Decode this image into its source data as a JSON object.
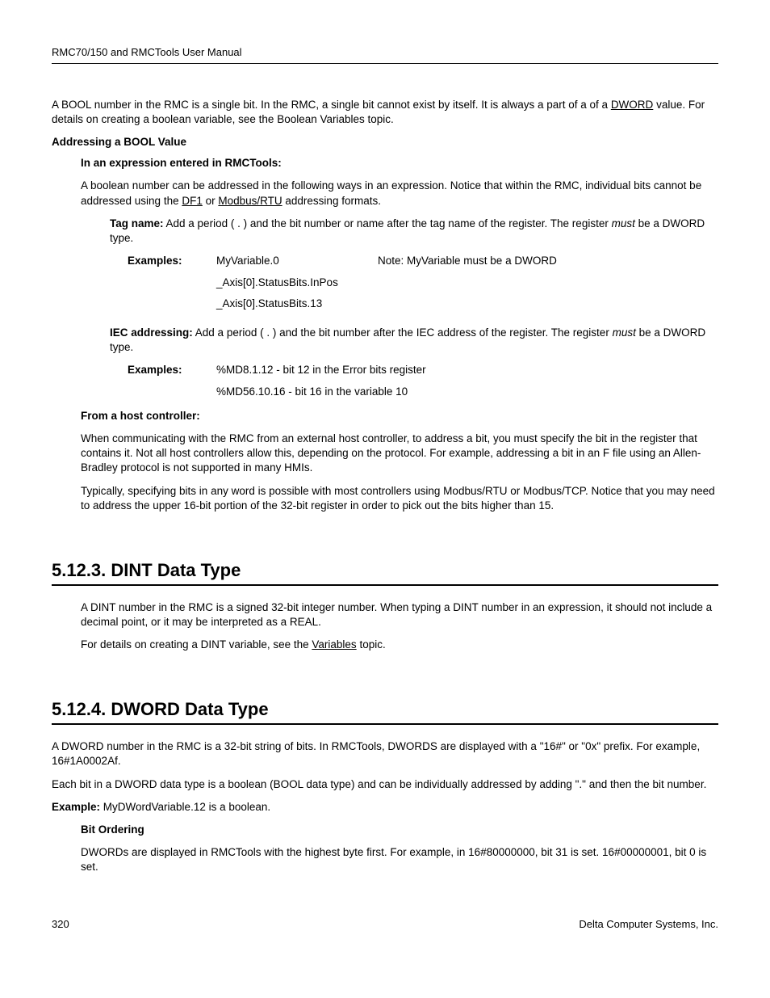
{
  "header": {
    "title": "RMC70/150 and RMCTools User Manual"
  },
  "intro": {
    "p1_a": "A BOOL number in the RMC is a single bit. In the RMC, a single bit cannot exist by itself. It is always a part of a of a ",
    "p1_link": "DWORD",
    "p1_b": " value. For details on creating a boolean variable, see the Boolean Variables topic."
  },
  "addressing": {
    "heading": "Addressing a BOOL Value",
    "expr_heading": "In an expression entered in RMCTools:",
    "expr_p_a": "A boolean number can be addressed in the following ways in an expression. Notice that within the RMC, individual bits cannot be addressed using the ",
    "expr_link1": "DF1",
    "expr_p_b": " or ",
    "expr_link2": "Modbus/RTU",
    "expr_p_c": " addressing formats.",
    "tag_label": "Tag name:",
    "tag_text_a": " Add a period ( . ) and the bit number or name after the tag name of the register. The register ",
    "tag_text_must": "must",
    "tag_text_b": " be a DWORD type.",
    "examples_label": "Examples:",
    "ex1_code": "MyVariable.0",
    "ex1_note": "Note: MyVariable must be a DWORD",
    "ex2_code": "_Axis[0].StatusBits.InPos",
    "ex3_code": "_Axis[0].StatusBits.13",
    "iec_label": "IEC addressing:",
    "iec_text_a": " Add a period ( . ) and the bit number after the IEC address of the register. The register ",
    "iec_text_must": "must",
    "iec_text_b": " be a DWORD type.",
    "iec_ex_label": "Examples:",
    "iec_ex1": "%MD8.1.12 - bit 12 in the Error bits register",
    "iec_ex2": "%MD56.10.16 - bit 16 in the variable 10",
    "host_heading": "From a host controller:",
    "host_p1": "When communicating with the RMC from an external host controller, to address a bit, you must specify the bit in the register that contains it. Not all host controllers allow this, depending on the protocol. For example, addressing a bit in an F file using an Allen-Bradley protocol is not supported in many HMIs.",
    "host_p2": "Typically, specifying bits in any word is possible with most controllers using Modbus/RTU or Modbus/TCP. Notice that you may need to address the upper 16-bit portion of the 32-bit register in order to pick out the bits higher than 15."
  },
  "dint": {
    "heading": "5.12.3. DINT Data Type",
    "p1": "A DINT number in the RMC is a signed 32-bit integer number. When typing a DINT number in an expression, it should not include a decimal point, or it may be interpreted as a REAL.",
    "p2_a": "For details on creating a DINT variable, see the ",
    "p2_link": "Variables",
    "p2_b": " topic."
  },
  "dword": {
    "heading": "5.12.4. DWORD Data Type",
    "p1": "A DWORD number in the RMC is a 32-bit string of bits. In RMCTools, DWORDS are displayed with a \"16#\" or \"0x\" prefix. For example, 16#1A0002Af.",
    "p2": "Each bit in a DWORD data type is a boolean (BOOL data type) and can be individually addressed by adding \".\" and then the bit number.",
    "example_label": "Example:",
    "example_text": " MyDWordVariable.12 is a boolean.",
    "bit_heading": "Bit Ordering",
    "bit_p": "DWORDs are displayed in RMCTools with the highest byte first. For example, in 16#80000000, bit 31 is set. 16#00000001, bit 0 is set."
  },
  "footer": {
    "page": "320",
    "company": "Delta Computer Systems, Inc."
  }
}
